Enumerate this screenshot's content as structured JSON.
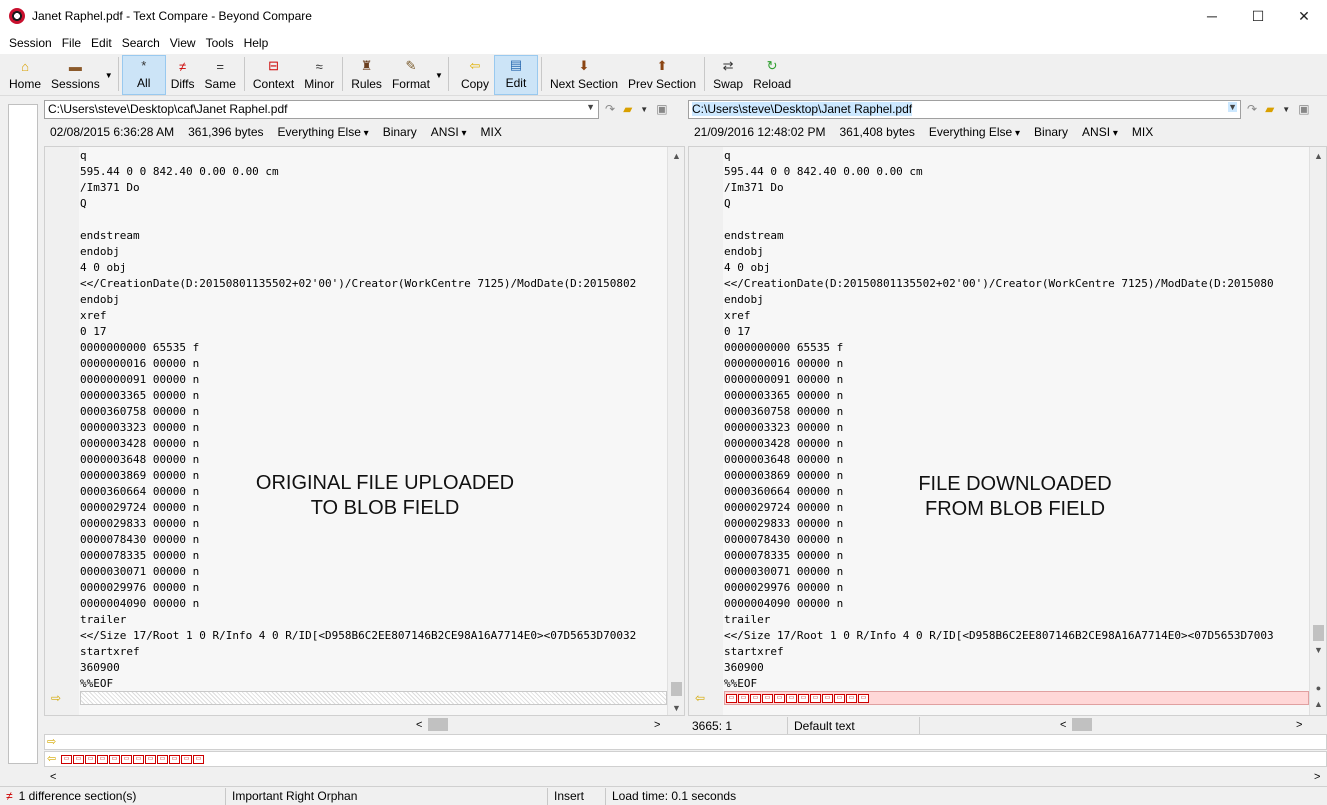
{
  "window": {
    "title": "Janet Raphel.pdf - Text Compare - Beyond Compare",
    "minimize": "─",
    "maximize": "☐",
    "close": "✕"
  },
  "menu": [
    "Session",
    "File",
    "Edit",
    "Search",
    "View",
    "Tools",
    "Help"
  ],
  "toolbar": {
    "home": "Home",
    "sessions": "Sessions",
    "all": "All",
    "diffs": "Diffs",
    "same": "Same",
    "context": "Context",
    "minor": "Minor",
    "rules": "Rules",
    "format": "Format",
    "copy": "Copy",
    "edit": "Edit",
    "next_section": "Next Section",
    "prev_section": "Prev Section",
    "swap": "Swap",
    "reload": "Reload"
  },
  "left": {
    "path": "C:\\Users\\steve\\Desktop\\caf\\Janet Raphel.pdf",
    "date": "02/08/2015 6:36:28 AM",
    "size": "361,396 bytes",
    "filter": "Everything Else",
    "mode": "Binary",
    "encoding": "ANSI",
    "lineend": "MIX",
    "overlay_line1": "ORIGINAL FILE UPLOADED",
    "overlay_line2": "TO BLOB FIELD"
  },
  "right": {
    "path": "C:\\Users\\steve\\Desktop\\Janet Raphel.pdf",
    "date": "21/09/2016 12:48:02 PM",
    "size": "361,408 bytes",
    "filter": "Everything Else",
    "mode": "Binary",
    "encoding": "ANSI",
    "lineend": "MIX",
    "overlay_line1": "FILE DOWNLOADED",
    "overlay_line2": "FROM BLOB FIELD",
    "position": "3665: 1",
    "text_style": "Default text"
  },
  "code_left": "q\n595.44 0 0 842.40 0.00 0.00 cm\n/Im371 Do\nQ\n\nendstream\nendobj\n4 0 obj\n<</CreationDate(D:20150801135502+02'00')/Creator(WorkCentre 7125)/ModDate(D:20150802\nendobj\nxref\n0 17\n0000000000 65535 f\n0000000016 00000 n\n0000000091 00000 n\n0000003365 00000 n\n0000360758 00000 n\n0000003323 00000 n\n0000003428 00000 n\n0000003648 00000 n\n0000003869 00000 n\n0000360664 00000 n\n0000029724 00000 n\n0000029833 00000 n\n0000078430 00000 n\n0000078335 00000 n\n0000030071 00000 n\n0000029976 00000 n\n0000004090 00000 n\ntrailer\n<</Size 17/Root 1 0 R/Info 4 0 R/ID[<D958B6C2EE807146B2CE98A16A7714E0><07D5653D70032\nstartxref\n360900\n%%EOF",
  "code_right": "q\n595.44 0 0 842.40 0.00 0.00 cm\n/Im371 Do\nQ\n\nendstream\nendobj\n4 0 obj\n<</CreationDate(D:20150801135502+02'00')/Creator(WorkCentre 7125)/ModDate(D:2015080\nendobj\nxref\n0 17\n0000000000 65535 f\n0000000016 00000 n\n0000000091 00000 n\n0000003365 00000 n\n0000360758 00000 n\n0000003323 00000 n\n0000003428 00000 n\n0000003648 00000 n\n0000003869 00000 n\n0000360664 00000 n\n0000029724 00000 n\n0000029833 00000 n\n0000078430 00000 n\n0000078335 00000 n\n0000030071 00000 n\n0000029976 00000 n\n0000004090 00000 n\ntrailer\n<</Size 17/Root 1 0 R/Info 4 0 R/ID[<D958B6C2EE807146B2CE98A16A7714E0><07D5653D7003\nstartxref\n360900\n%%EOF",
  "status": {
    "diff_sections": "1 difference section(s)",
    "orphan": "Important Right Orphan",
    "mode": "Insert",
    "load_time": "Load time: 0.1 seconds"
  }
}
